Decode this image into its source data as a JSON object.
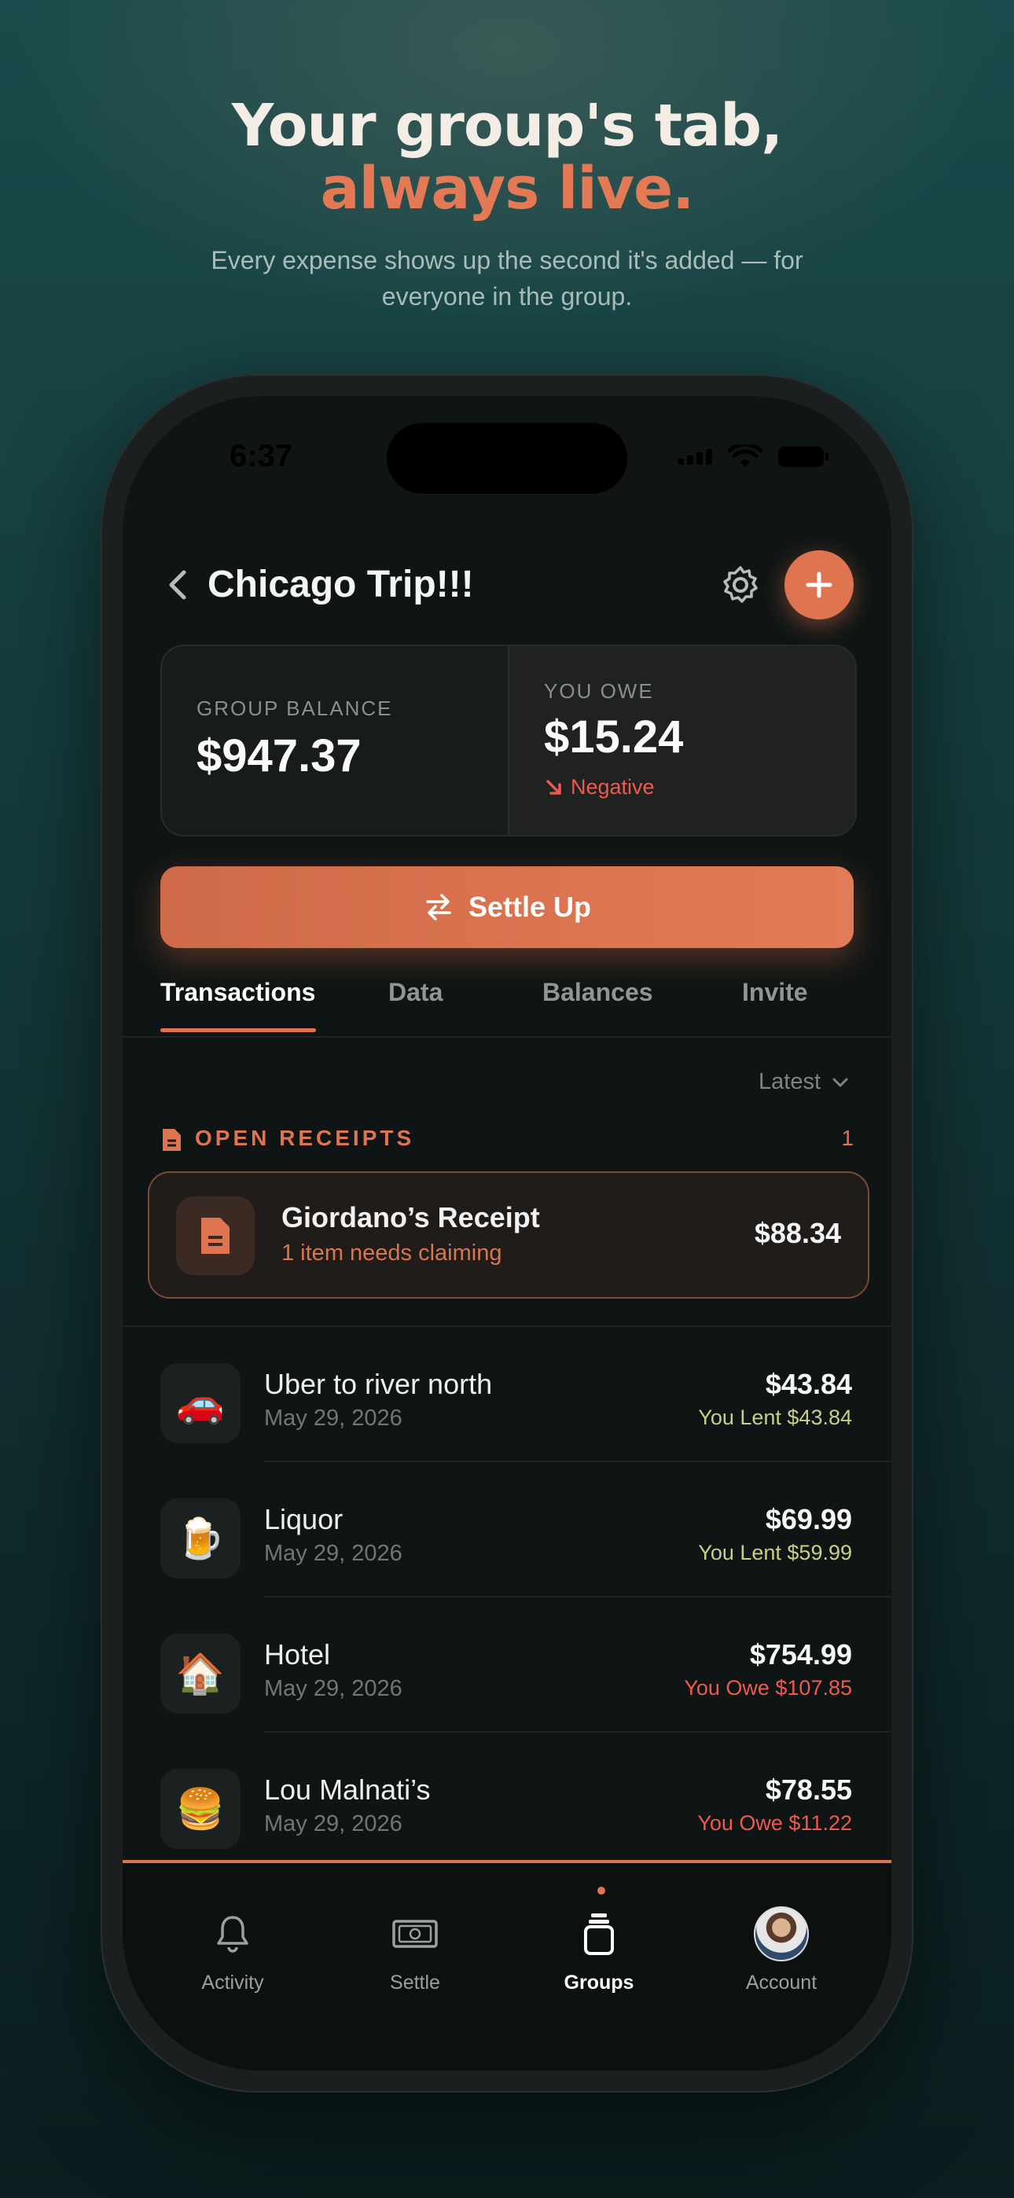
{
  "hero": {
    "title": "Your group's tab,",
    "accent": "always live.",
    "subtitle": "Every expense shows up the second it's added — for everyone in the group."
  },
  "status_bar": {
    "time": "6:37"
  },
  "header": {
    "title": "Chicago Trip!!!"
  },
  "balance": {
    "group_label": "GROUP BALANCE",
    "group_amount": "$947.37",
    "owe_label": "YOU OWE",
    "owe_amount": "$15.24",
    "owe_status": "Negative"
  },
  "settle": {
    "label": "Settle Up"
  },
  "tabs": [
    {
      "label": "Transactions",
      "active": true
    },
    {
      "label": "Data",
      "active": false
    },
    {
      "label": "Balances",
      "active": false
    },
    {
      "label": "Invite",
      "active": false
    }
  ],
  "sort": {
    "label": "Latest"
  },
  "open_receipts": {
    "label": "OPEN RECEIPTS",
    "count": "1",
    "items": [
      {
        "title": "Giordano’s Receipt",
        "subtitle": "1 item needs claiming",
        "amount": "$88.34",
        "icon": "document-icon"
      }
    ]
  },
  "transactions": [
    {
      "emoji": "🚗",
      "name": "Uber to river north",
      "date": "May 29, 2026",
      "amount": "$43.84",
      "status": "You Lent $43.84",
      "type": "lent"
    },
    {
      "emoji": "🍺",
      "name": "Liquor",
      "date": "May 29, 2026",
      "amount": "$69.99",
      "status": "You Lent $59.99",
      "type": "lent"
    },
    {
      "emoji": "🏠",
      "name": "Hotel",
      "date": "May 29, 2026",
      "amount": "$754.99",
      "status": "You Owe $107.85",
      "type": "owe"
    },
    {
      "emoji": "🍔",
      "name": "Lou Malnati’s",
      "date": "May 29, 2026",
      "amount": "$78.55",
      "status": "You Owe $11.22",
      "type": "owe"
    }
  ],
  "tabbar": [
    {
      "label": "Activity",
      "icon": "bell-icon"
    },
    {
      "label": "Settle",
      "icon": "cash-icon"
    },
    {
      "label": "Groups",
      "icon": "groups-icon",
      "active": true
    },
    {
      "label": "Account",
      "icon": "avatar"
    }
  ],
  "colors": {
    "accent": "#df7450",
    "negative": "#ef5a4f",
    "lent": "#c8cf86"
  }
}
